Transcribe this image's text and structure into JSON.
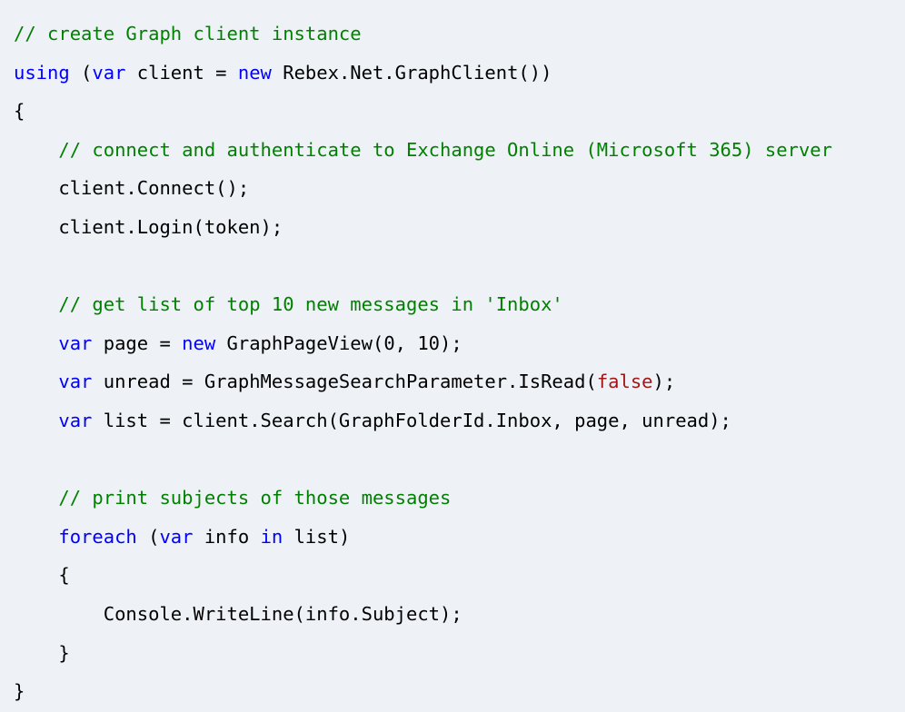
{
  "colors": {
    "background": "#eef2f6",
    "comment": "#008000",
    "keyword": "#0000ff",
    "literal": "#a31515",
    "plain": "#000000"
  },
  "code": {
    "lines": [
      [
        {
          "t": "comment",
          "v": "// create Graph client instance"
        }
      ],
      [
        {
          "t": "keyword",
          "v": "using"
        },
        {
          "t": "plain",
          "v": " ("
        },
        {
          "t": "keyword",
          "v": "var"
        },
        {
          "t": "plain",
          "v": " client = "
        },
        {
          "t": "keyword",
          "v": "new"
        },
        {
          "t": "plain",
          "v": " Rebex.Net.GraphClient())"
        }
      ],
      [
        {
          "t": "plain",
          "v": "{"
        }
      ],
      [
        {
          "t": "plain",
          "v": "    "
        },
        {
          "t": "comment",
          "v": "// connect and authenticate to Exchange Online (Microsoft 365) server"
        }
      ],
      [
        {
          "t": "plain",
          "v": "    client.Connect();"
        }
      ],
      [
        {
          "t": "plain",
          "v": "    client.Login(token);"
        }
      ],
      [],
      [
        {
          "t": "plain",
          "v": "    "
        },
        {
          "t": "comment",
          "v": "// get list of top 10 new messages in 'Inbox'"
        }
      ],
      [
        {
          "t": "plain",
          "v": "    "
        },
        {
          "t": "keyword",
          "v": "var"
        },
        {
          "t": "plain",
          "v": " page = "
        },
        {
          "t": "keyword",
          "v": "new"
        },
        {
          "t": "plain",
          "v": " GraphPageView(0, 10);"
        }
      ],
      [
        {
          "t": "plain",
          "v": "    "
        },
        {
          "t": "keyword",
          "v": "var"
        },
        {
          "t": "plain",
          "v": " unread = GraphMessageSearchParameter.IsRead("
        },
        {
          "t": "literal",
          "v": "false"
        },
        {
          "t": "plain",
          "v": ");"
        }
      ],
      [
        {
          "t": "plain",
          "v": "    "
        },
        {
          "t": "keyword",
          "v": "var"
        },
        {
          "t": "plain",
          "v": " list = client.Search(GraphFolderId.Inbox, page, unread);"
        }
      ],
      [],
      [
        {
          "t": "plain",
          "v": "    "
        },
        {
          "t": "comment",
          "v": "// print subjects of those messages"
        }
      ],
      [
        {
          "t": "plain",
          "v": "    "
        },
        {
          "t": "keyword",
          "v": "foreach"
        },
        {
          "t": "plain",
          "v": " ("
        },
        {
          "t": "keyword",
          "v": "var"
        },
        {
          "t": "plain",
          "v": " info "
        },
        {
          "t": "keyword",
          "v": "in"
        },
        {
          "t": "plain",
          "v": " list)"
        }
      ],
      [
        {
          "t": "plain",
          "v": "    {"
        }
      ],
      [
        {
          "t": "plain",
          "v": "        Console.WriteLine(info.Subject);"
        }
      ],
      [
        {
          "t": "plain",
          "v": "    }"
        }
      ],
      [
        {
          "t": "plain",
          "v": "}"
        }
      ]
    ]
  }
}
